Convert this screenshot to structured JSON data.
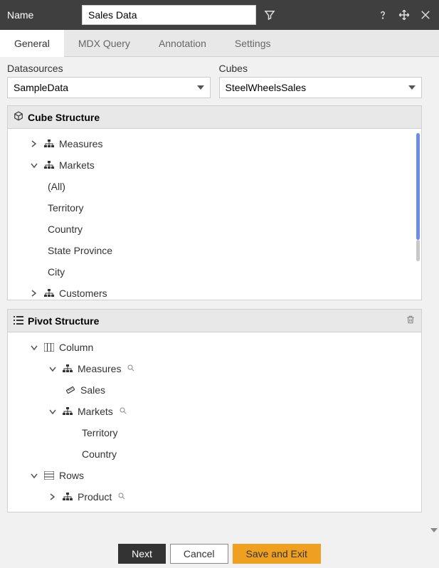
{
  "header": {
    "name_label": "Name",
    "name_value": "Sales Data"
  },
  "tabs": [
    "General",
    "MDX Query",
    "Annotation",
    "Settings"
  ],
  "active_tab": 0,
  "datasources": {
    "label": "Datasources",
    "value": "SampleData"
  },
  "cubes": {
    "label": "Cubes",
    "value": "SteelWheelsSales"
  },
  "cube_structure": {
    "title": "Cube Structure",
    "nodes": [
      {
        "label": "Measures",
        "expanded": false,
        "icon": "hierarchy"
      },
      {
        "label": "Markets",
        "expanded": true,
        "icon": "hierarchy",
        "children": [
          "(All)",
          "Territory",
          "Country",
          "State Province",
          "City"
        ]
      },
      {
        "label": "Customers",
        "expanded": false,
        "icon": "hierarchy"
      }
    ]
  },
  "pivot_structure": {
    "title": "Pivot Structure",
    "column": {
      "label": "Column",
      "children": [
        {
          "label": "Measures",
          "icon": "hierarchy",
          "search": true,
          "expanded": true,
          "children": [
            {
              "label": "Sales",
              "icon": "measure"
            }
          ]
        },
        {
          "label": "Markets",
          "icon": "hierarchy",
          "search": true,
          "expanded": true,
          "children": [
            {
              "label": "Territory"
            },
            {
              "label": "Country"
            }
          ]
        }
      ]
    },
    "rows": {
      "label": "Rows",
      "children": [
        {
          "label": "Product",
          "icon": "hierarchy",
          "search": true,
          "expanded": false
        }
      ]
    }
  },
  "footer": {
    "next": "Next",
    "cancel": "Cancel",
    "save": "Save and Exit"
  }
}
